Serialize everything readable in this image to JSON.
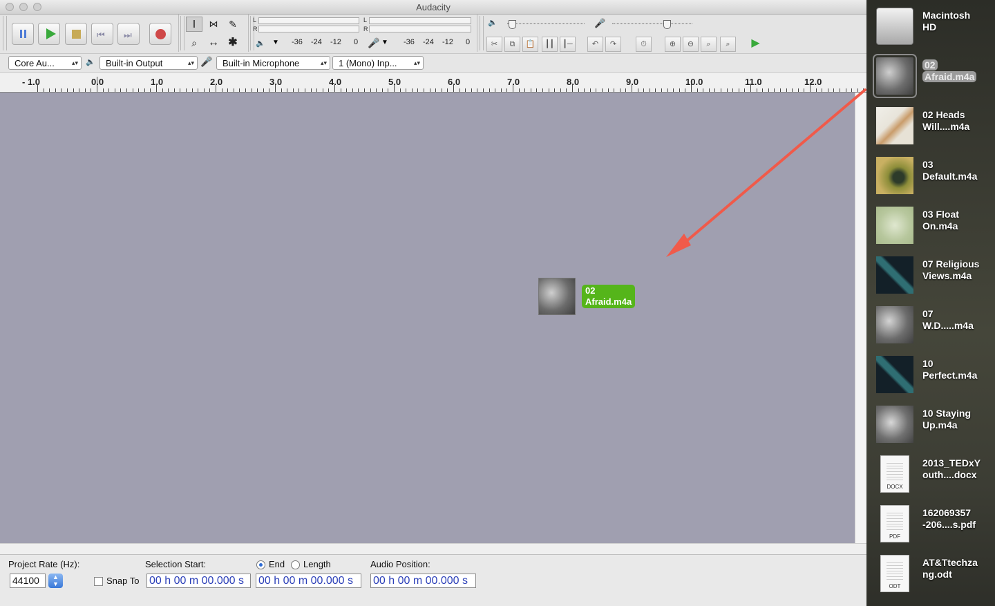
{
  "window": {
    "title": "Audacity"
  },
  "transport": {
    "buttons": [
      "pause",
      "play",
      "stop",
      "skip-start",
      "skip-end",
      "record"
    ]
  },
  "meters": {
    "play_scale": [
      "-36",
      "-24",
      "-12",
      "0"
    ],
    "rec_scale": [
      "-36",
      "-24",
      "-12",
      "0"
    ],
    "left_channel": "L",
    "right_channel": "R"
  },
  "device_toolbar": {
    "host": "Core Au...",
    "output_device": "Built-in Output",
    "input_device": "Built-in Microphone",
    "input_channels": "1 (Mono) Inp..."
  },
  "ruler": {
    "labels": [
      "- 1.0",
      "0.0",
      "1.0",
      "2.0",
      "3.0",
      "4.0",
      "5.0",
      "6.0",
      "7.0",
      "8.0",
      "9.0",
      "10.0",
      "11.0",
      "12.0"
    ]
  },
  "drag_item": {
    "label_line1": "02",
    "label_line2": "Afraid.m4a"
  },
  "selection_toolbar": {
    "project_rate_label": "Project Rate (Hz):",
    "project_rate_value": "44100",
    "snap_to_label": "Snap To",
    "selection_start_label": "Selection Start:",
    "end_label": "End",
    "length_label": "Length",
    "audio_position_label": "Audio Position:",
    "selection_start_value": "00 h 00 m 00.000 s",
    "end_value": "00 h 00 m 00.000 s",
    "audio_position_value": "00 h 00 m 00.000 s",
    "end_selected": true,
    "snap_to_checked": false
  },
  "desktop": {
    "items": [
      {
        "line1": "Macintosh",
        "line2": "HD",
        "icon": "hard-drive-icon",
        "selected": false
      },
      {
        "line1": "02",
        "line2": "Afraid.m4a",
        "icon": "album-art-icon",
        "selected": true
      },
      {
        "line1": "02 Heads",
        "line2": "Will....m4a",
        "icon": "album-art-icon",
        "selected": false
      },
      {
        "line1": "03",
        "line2": "Default.m4a",
        "icon": "album-art-icon",
        "selected": false
      },
      {
        "line1": "03 Float",
        "line2": "On.m4a",
        "icon": "album-art-icon",
        "selected": false
      },
      {
        "line1": "07 Religious",
        "line2": "Views.m4a",
        "icon": "album-art-icon",
        "selected": false
      },
      {
        "line1": "07",
        "line2": "W.D.....m4a",
        "icon": "album-art-icon",
        "selected": false
      },
      {
        "line1": "10",
        "line2": "Perfect.m4a",
        "icon": "album-art-icon",
        "selected": false
      },
      {
        "line1": "10 Staying",
        "line2": "Up.m4a",
        "icon": "album-art-icon",
        "selected": false
      },
      {
        "line1": "2013_TEDxY",
        "line2": "outh....docx",
        "icon": "docx-file-icon",
        "tag": "DOCX",
        "selected": false
      },
      {
        "line1": "162069357",
        "line2": "-206....s.pdf",
        "icon": "pdf-file-icon",
        "tag": "PDF",
        "selected": false
      },
      {
        "line1": "AT&Ttechza",
        "line2": "ng.odt",
        "icon": "odt-file-icon",
        "tag": "ODT",
        "selected": false
      }
    ]
  },
  "annotation": {
    "arrow_color": "#f05a4a"
  },
  "colors": {
    "track_area": "#a09fb0",
    "drag_label": "#55b51a",
    "time_digits": "#2b3fb8"
  }
}
